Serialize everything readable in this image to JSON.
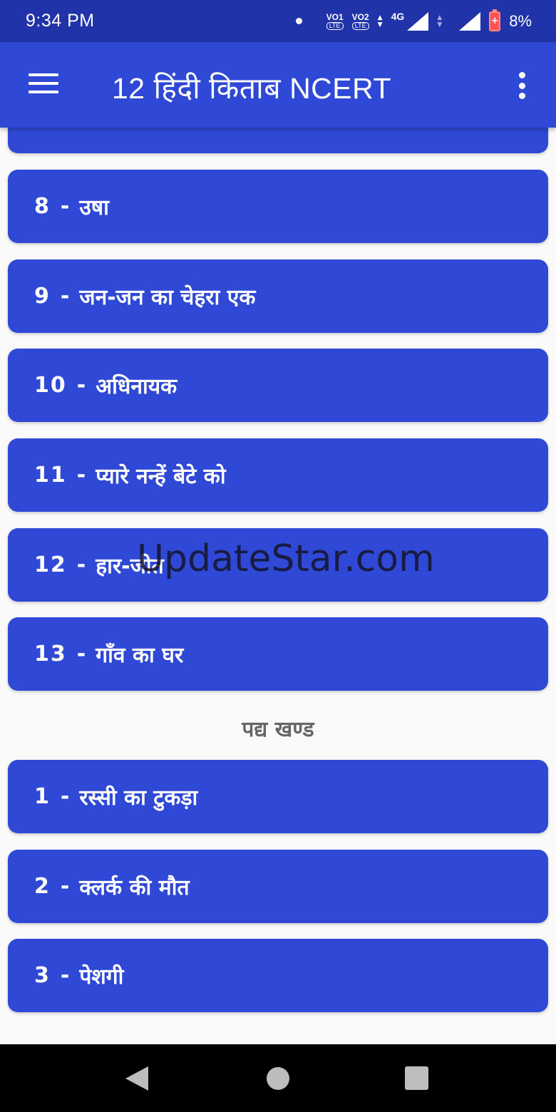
{
  "status_bar": {
    "time": "9:34 PM",
    "sim1": {
      "vo": "VO",
      "slot": "1",
      "lte": "LTE"
    },
    "sim2": {
      "vo": "VO",
      "slot": "2",
      "lte": "LTE"
    },
    "network": "4G",
    "battery_percent": "8%"
  },
  "app_bar": {
    "title": "12 हिंदी किताब NCERT",
    "menu_icon": "hamburger-menu-icon",
    "overflow_icon": "more-vert-icon"
  },
  "list": {
    "section_one_items": [
      {
        "num": "8",
        "title": "उषा"
      },
      {
        "num": "9",
        "title": "जन-जन का चेहरा एक"
      },
      {
        "num": "10",
        "title": "अधिनायक"
      },
      {
        "num": "11",
        "title": "प्यारे नन्हें बेटे को"
      },
      {
        "num": "12",
        "title": "हार-जीत"
      },
      {
        "num": "13",
        "title": "गाँव का घर"
      }
    ],
    "section_two_title": "पद्य खण्ड",
    "section_two_items": [
      {
        "num": "1",
        "title": "रस्सी का टुकड़ा"
      },
      {
        "num": "2",
        "title": "क्लर्क की मौत"
      },
      {
        "num": "3",
        "title": "पेशगी"
      }
    ],
    "separator": "-"
  },
  "watermark": "UpdateStar.com",
  "colors": {
    "status_bar": "#2133a8",
    "primary": "#2f48d6",
    "section_title": "#666666",
    "nav_bar": "#000000"
  }
}
